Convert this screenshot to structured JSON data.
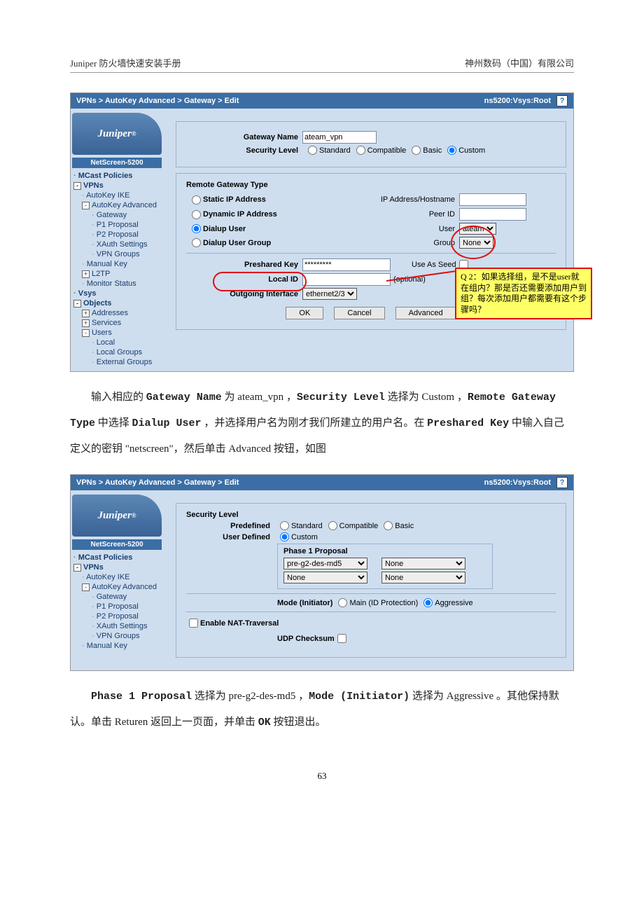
{
  "header": {
    "left": "Juniper 防火墙快速安装手册",
    "right": "神州数码（中国）有限公司"
  },
  "page_number": "63",
  "shot1": {
    "breadcrumb": "VPNs > AutoKey Advanced > Gateway > Edit",
    "sys": "ns5200:Vsys:Root",
    "logo": "Juniper",
    "device": "NetScreen-5200",
    "tree": [
      {
        "lvl": 1,
        "box": "",
        "t": "MCast Policies"
      },
      {
        "lvl": 1,
        "box": "-",
        "t": "VPNs"
      },
      {
        "lvl": 2,
        "box": "",
        "t": "AutoKey IKE"
      },
      {
        "lvl": 2,
        "box": "-",
        "t": "AutoKey Advanced"
      },
      {
        "lvl": 3,
        "box": "",
        "t": "Gateway"
      },
      {
        "lvl": 3,
        "box": "",
        "t": "P1 Proposal"
      },
      {
        "lvl": 3,
        "box": "",
        "t": "P2 Proposal"
      },
      {
        "lvl": 3,
        "box": "",
        "t": "XAuth Settings"
      },
      {
        "lvl": 3,
        "box": "",
        "t": "VPN Groups"
      },
      {
        "lvl": 2,
        "box": "",
        "t": "Manual Key"
      },
      {
        "lvl": 2,
        "box": "+",
        "t": "L2TP"
      },
      {
        "lvl": 2,
        "box": "",
        "t": "Monitor Status"
      },
      {
        "lvl": 1,
        "box": "",
        "t": "Vsys"
      },
      {
        "lvl": 1,
        "box": "-",
        "t": "Objects"
      },
      {
        "lvl": 2,
        "box": "+",
        "t": "Addresses"
      },
      {
        "lvl": 2,
        "box": "+",
        "t": "Services"
      },
      {
        "lvl": 2,
        "box": "-",
        "t": "Users"
      },
      {
        "lvl": 3,
        "box": "",
        "t": "Local"
      },
      {
        "lvl": 3,
        "box": "",
        "t": "Local Groups"
      },
      {
        "lvl": 3,
        "box": "",
        "t": "External Groups"
      }
    ],
    "labels": {
      "gateway_name": "Gateway Name",
      "gateway_val": "ateam_vpn",
      "sec_level": "Security Level",
      "sec_std": "Standard",
      "sec_comp": "Compatible",
      "sec_basic": "Basic",
      "sec_custom": "Custom",
      "rgt": "Remote Gateway Type",
      "static_ip": "Static IP Address",
      "ip_hostname": "IP Address/Hostname",
      "dyn_ip": "Dynamic IP Address",
      "peer_id": "Peer ID",
      "dialup_user": "Dialup User",
      "user": "User",
      "user_val": "ateam",
      "dialup_group": "Dialup User Group",
      "group": "Group",
      "group_val": "None",
      "psk": "Preshared Key",
      "psk_val": "*********",
      "seed": "Use As Seed",
      "local_id": "Local ID",
      "optional": "(optional)",
      "out_if": "Outgoing Interface",
      "out_if_val": "ethernet2/3",
      "ok": "OK",
      "cancel": "Cancel",
      "adv": "Advanced"
    },
    "callout": "Q 2：如果选择组，是不是user就在组内？那是否还需要添加用户到组？每次添加用户都需要有这个步骤吗？"
  },
  "para1": {
    "a": "输入相应的 ",
    "b": "Gateway Name",
    "c": " 为 ateam_vpn ，",
    "d": "Security Level",
    "e": " 选择为 Custom ，",
    "f": "Remote Gateway Type",
    "g": " 中选择 ",
    "h": "Dialup User",
    "i": " ，并选择用户名为刚才我们所建立的用户名。在 ",
    "j": "Preshared Key",
    "k": " 中输入自己定义的密钥 \"netscreen\"，然后单击 Advanced 按钮，如图"
  },
  "shot2": {
    "breadcrumb": "VPNs > AutoKey Advanced > Gateway > Edit",
    "sys": "ns5200:Vsys:Root",
    "logo": "Juniper",
    "device": "NetScreen-5200",
    "tree": [
      {
        "lvl": 1,
        "box": "",
        "t": "MCast Policies"
      },
      {
        "lvl": 1,
        "box": "-",
        "t": "VPNs"
      },
      {
        "lvl": 2,
        "box": "",
        "t": "AutoKey IKE"
      },
      {
        "lvl": 2,
        "box": "-",
        "t": "AutoKey Advanced"
      },
      {
        "lvl": 3,
        "box": "",
        "t": "Gateway"
      },
      {
        "lvl": 3,
        "box": "",
        "t": "P1 Proposal"
      },
      {
        "lvl": 3,
        "box": "",
        "t": "P2 Proposal"
      },
      {
        "lvl": 3,
        "box": "",
        "t": "XAuth Settings"
      },
      {
        "lvl": 3,
        "box": "",
        "t": "VPN Groups"
      },
      {
        "lvl": 2,
        "box": "",
        "t": "Manual Key"
      }
    ],
    "labels": {
      "sec_level": "Security Level",
      "predef": "Predefined",
      "std": "Standard",
      "comp": "Compatible",
      "basic": "Basic",
      "userdef": "User Defined",
      "custom": "Custom",
      "p1p": "Phase 1 Proposal",
      "p1_a": "pre-g2-des-md5",
      "p1_b": "None",
      "p1_c": "None",
      "p1_d": "None",
      "mode": "Mode (Initiator)",
      "main": "Main (ID Protection)",
      "aggr": "Aggressive",
      "nat": "Enable NAT-Traversal",
      "udp": "UDP Checksum"
    }
  },
  "para2": {
    "a": "Phase 1 Proposal",
    "b": " 选择为 pre-g2-des-md5 ，",
    "c": "Mode (Initiator)",
    "d": " 选择为 Aggressive 。其他保持默认。单击 Returen 返回上一页面，并单击 ",
    "e": "OK",
    "f": " 按钮退出。"
  }
}
